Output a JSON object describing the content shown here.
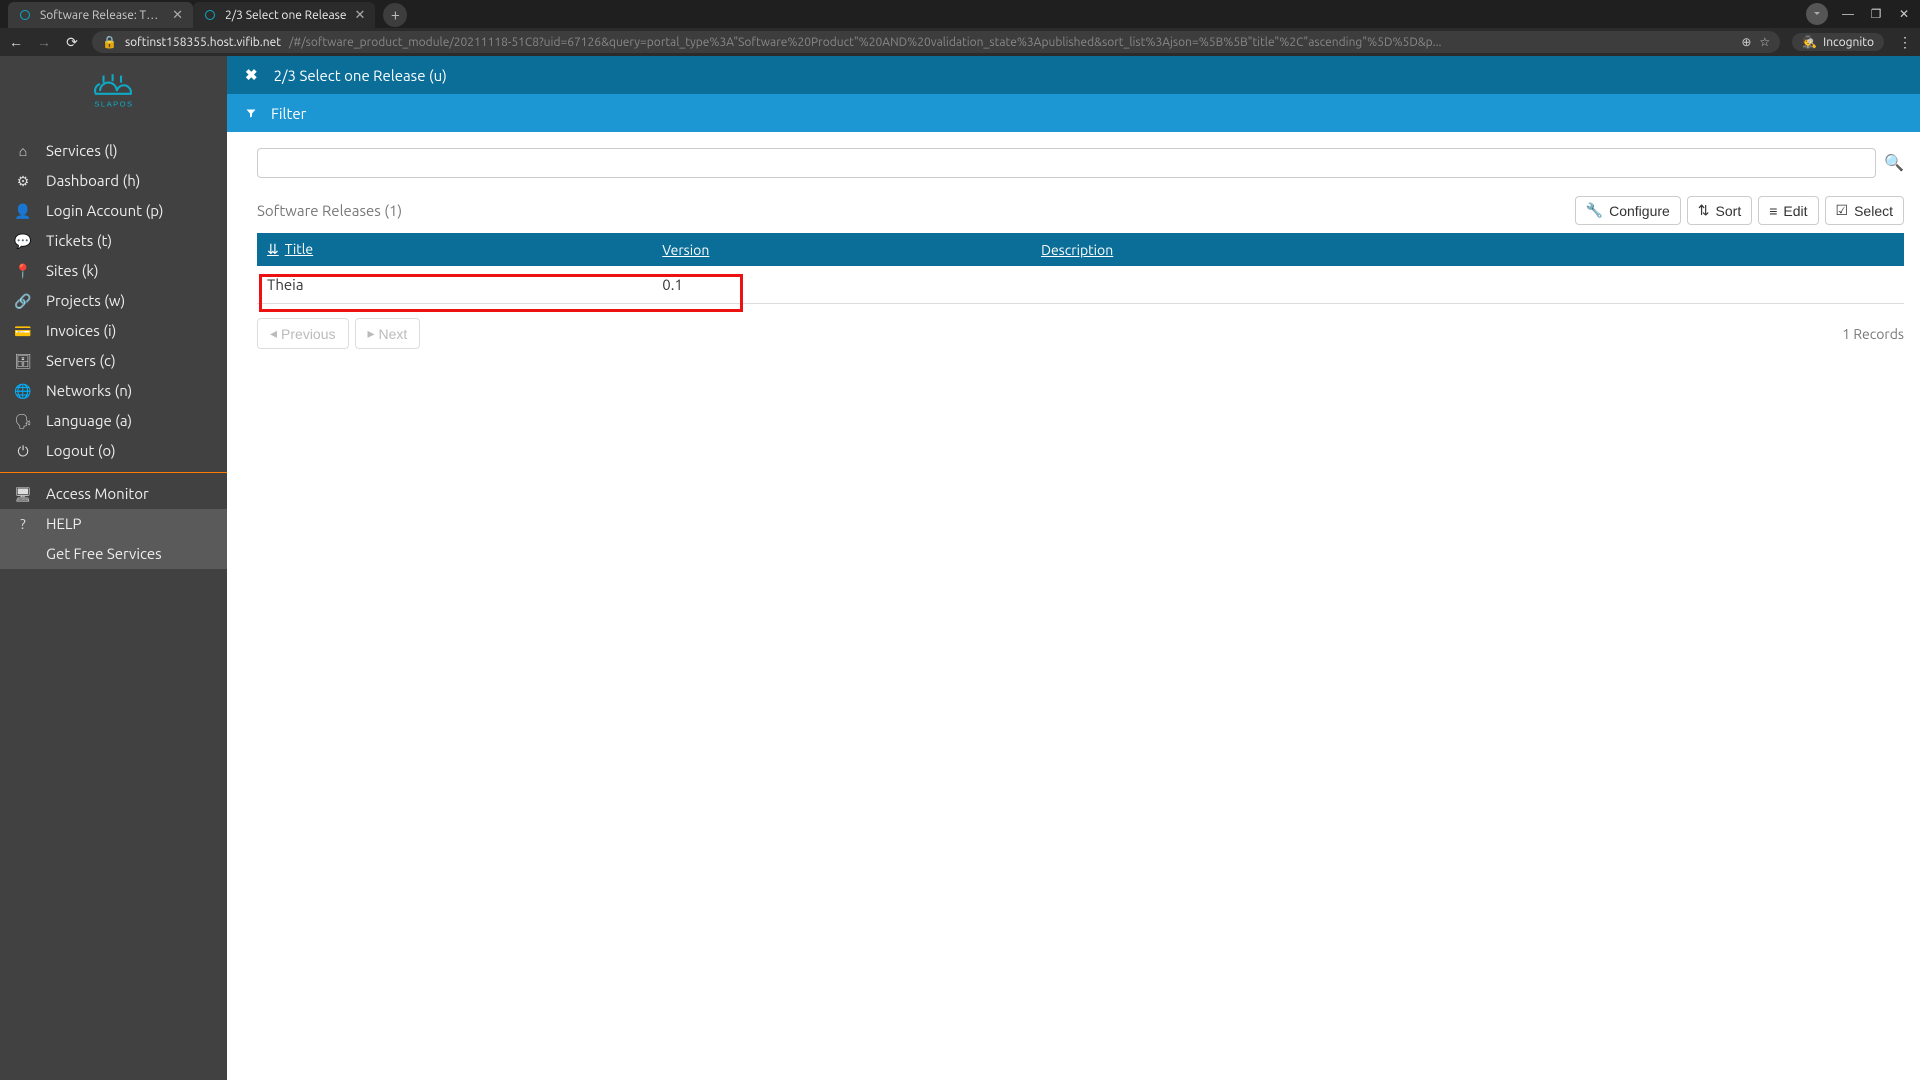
{
  "browser": {
    "tabs": [
      {
        "title": "Software Release: Theia",
        "active": false
      },
      {
        "title": "2/3 Select one Release",
        "active": true
      }
    ],
    "url_host": "softinst158355.host.vifib.net",
    "url_path": "/#/software_product_module/20211118-51C8?uid=67126&query=portal_type%3A\"Software%20Product\"%20AND%20validation_state%3Apublished&sort_list%3Ajson=%5B%5B\"title\"%2C\"ascending\"%5D%5D&p...",
    "incognito_label": "Incognito"
  },
  "sidebar": {
    "brand": "SLAPOS",
    "items": [
      {
        "icon": "home-icon",
        "glyph": "⌂",
        "label": "Services (l)"
      },
      {
        "icon": "dashboard-icon",
        "glyph": "⚙",
        "label": "Dashboard (h)"
      },
      {
        "icon": "user-icon",
        "glyph": "👤",
        "label": "Login Account (p)"
      },
      {
        "icon": "comments-icon",
        "glyph": "💬",
        "label": "Tickets (t)"
      },
      {
        "icon": "marker-icon",
        "glyph": "📍",
        "label": "Sites (k)"
      },
      {
        "icon": "share-icon",
        "glyph": "🔗",
        "label": "Projects (w)"
      },
      {
        "icon": "card-icon",
        "glyph": "💳",
        "label": "Invoices (i)"
      },
      {
        "icon": "database-icon",
        "glyph": "🗄",
        "label": "Servers (c)"
      },
      {
        "icon": "globe-icon",
        "glyph": "🌐",
        "label": "Networks (n)"
      },
      {
        "icon": "language-icon",
        "glyph": "🗣",
        "label": "Language (a)"
      },
      {
        "icon": "power-icon",
        "glyph": "⏻",
        "label": "Logout (o)"
      }
    ],
    "secondary": [
      {
        "icon": "monitor-icon",
        "glyph": "🖥",
        "label": "Access Monitor"
      },
      {
        "icon": "help-icon",
        "glyph": "?",
        "label": "HELP"
      },
      {
        "icon": "",
        "glyph": "",
        "label": "Get Free Services"
      }
    ]
  },
  "header": {
    "title": "2/3 Select one Release (u)"
  },
  "filter": {
    "label": "Filter"
  },
  "table": {
    "title": "Software Releases (1)",
    "columns": [
      "Title",
      "Version",
      "Description"
    ],
    "rows": [
      {
        "title": "Theia",
        "version": "0.1",
        "description": ""
      }
    ],
    "actions": {
      "configure": "Configure",
      "sort": "Sort",
      "edit": "Edit",
      "select": "Select"
    },
    "pager": {
      "previous": "Previous",
      "next": "Next",
      "records": "1 Records"
    }
  }
}
